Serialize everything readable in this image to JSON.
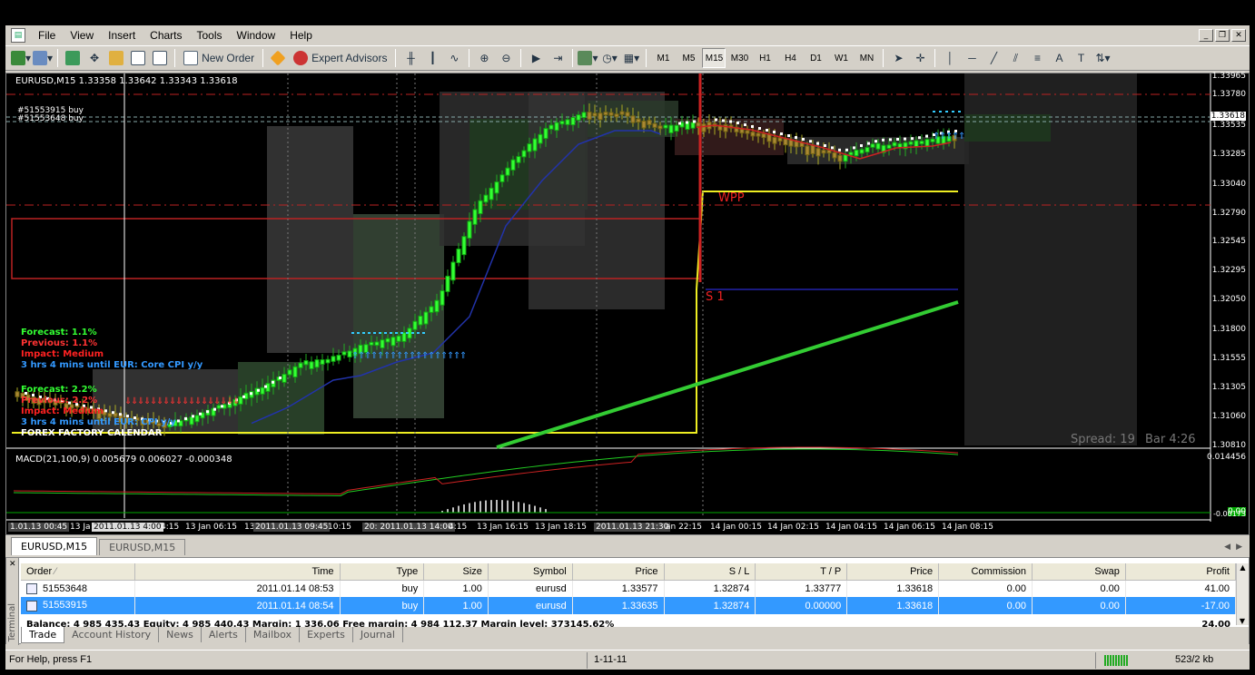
{
  "menu": {
    "items": [
      "File",
      "View",
      "Insert",
      "Charts",
      "Tools",
      "Window",
      "Help"
    ]
  },
  "toolbar": {
    "new_order": "New Order",
    "expert_advisors": "Expert Advisors",
    "timeframes": [
      "M1",
      "M5",
      "M15",
      "M30",
      "H1",
      "H4",
      "D1",
      "W1",
      "MN"
    ],
    "active_timeframe": "M15"
  },
  "chart": {
    "symbol_info": "EURUSD,M15  1.33358 1.33642 1.33343 1.33618",
    "position_labels": [
      "#51553915 buy",
      "#51553648 buy"
    ],
    "macd_label": "MACD(21,100,9) 0.005679 0.006027 -0.000348",
    "price_ticks": [
      "1.33965",
      "1.33780",
      "1.33535",
      "1.33285",
      "1.33040",
      "1.32790",
      "1.32545",
      "1.32295",
      "1.32050",
      "1.31800",
      "1.31555",
      "1.31305",
      "1.31060",
      "1.30810"
    ],
    "current_price": "1.33618",
    "macd_ticks": [
      "0.014456",
      "0.00",
      "-0.00173"
    ],
    "pivot_labels": {
      "wpp": "WPP",
      "s1": "S 1"
    },
    "news1": {
      "forecast": "Forecast: 1.1%",
      "previous": "Previous: 1.1%",
      "impact": "Impact: Medium",
      "until": "3 hrs 4 mins until EUR: Core CPI y/y"
    },
    "news2": {
      "forecast": "Forecast: 2.2%",
      "previous": "Previous: 2.2%",
      "impact": "Impact: Medium",
      "until": "3 hrs 4 mins until EUR: CPI y/y",
      "source": "FOREX FACTORY CALENDAR"
    },
    "spread": "Spread: 19",
    "bar_time": "Bar  4:26",
    "time_labels": [
      "1.01.13 00:45",
      "13 Ja",
      "2011.01.13 4:00",
      "4:15",
      "13 Jan 06:15",
      "13 Jan 08:15",
      "2011.01.13 09:45",
      "10:15",
      "20: 2011.01.13 14:00",
      "4:15",
      "13 Jan 16:15",
      "13 Jan 18:15",
      "2011.01.13 21:30",
      "an 22:15",
      "14 Jan 00:15",
      "14 Jan 02:15",
      "14 Jan 04:15",
      "14 Jan 06:15",
      "14 Jan 08:15"
    ]
  },
  "chart_tabs": [
    "EURUSD,M15",
    "EURUSD,M15"
  ],
  "terminal": {
    "columns": [
      "Order",
      "Time",
      "Type",
      "Size",
      "Symbol",
      "Price",
      "S / L",
      "T / P",
      "Price",
      "Commission",
      "Swap",
      "Profit"
    ],
    "rows": [
      [
        "51553648",
        "2011.01.14 08:53",
        "buy",
        "1.00",
        "eurusd",
        "1.33577",
        "1.32874",
        "1.33777",
        "1.33618",
        "0.00",
        "0.00",
        "41.00"
      ],
      [
        "51553915",
        "2011.01.14 08:54",
        "buy",
        "1.00",
        "eurusd",
        "1.33635",
        "1.32874",
        "0.00000",
        "1.33618",
        "0.00",
        "0.00",
        "-17.00"
      ]
    ],
    "balance_line": "Balance: 4 985 435.43  Equity: 4 985 440.43  Margin: 1 336.06  Free margin: 4 984 112.37  Margin level: 373145.62%",
    "balance_profit": "24.00",
    "side_label": "Terminal",
    "tabs": [
      "Trade",
      "Account History",
      "News",
      "Alerts",
      "Mailbox",
      "Experts",
      "Journal"
    ]
  },
  "status": {
    "help": "For Help, press F1",
    "profile": "1-11-11",
    "traffic": "523/2 kb"
  }
}
